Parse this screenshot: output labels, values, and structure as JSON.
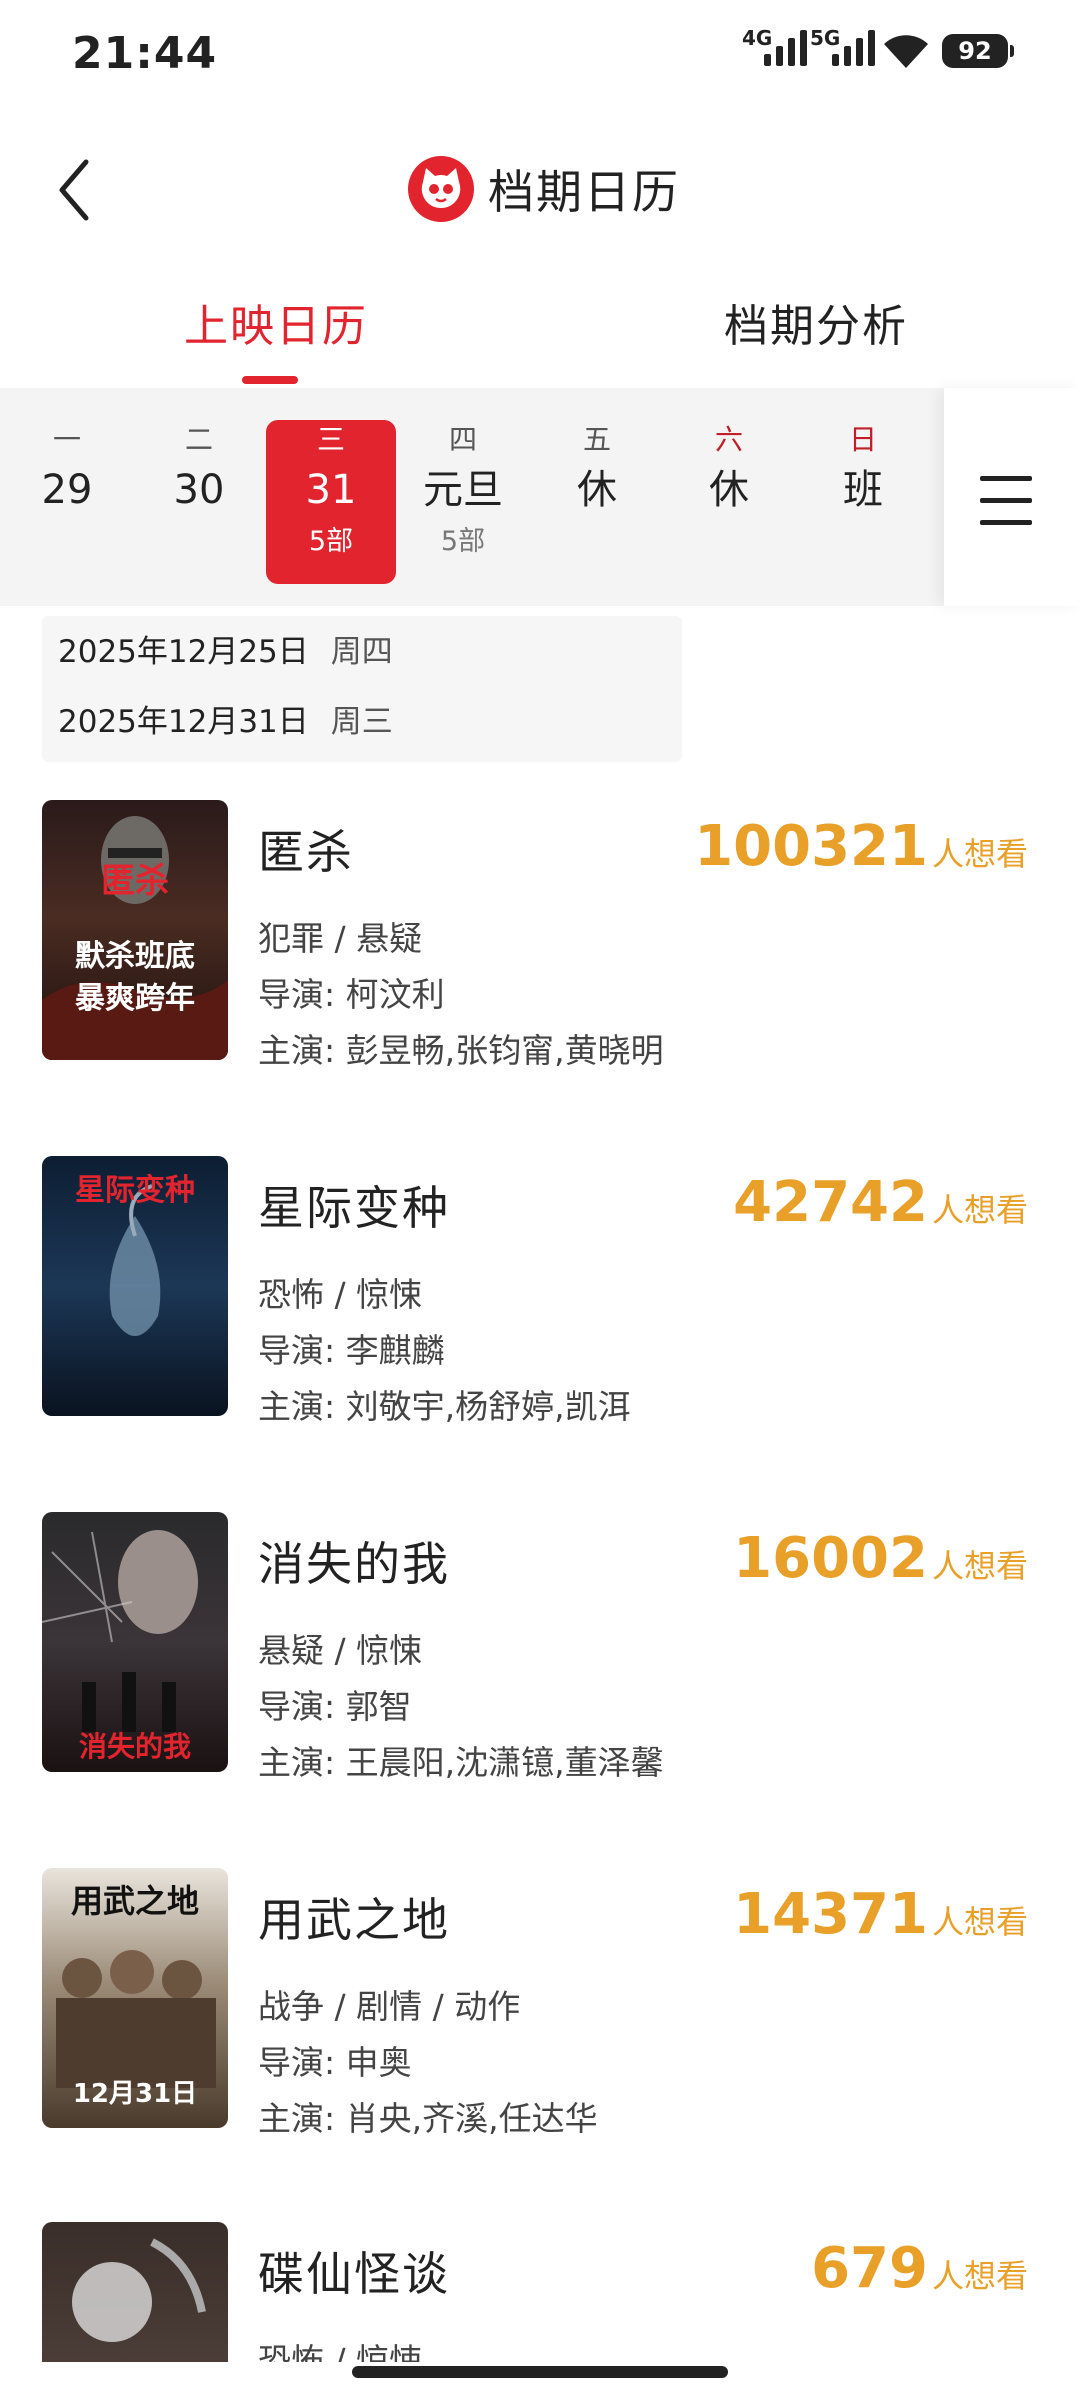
{
  "status_bar": {
    "time": "21:44",
    "network_1": "4G",
    "network_2": "5G",
    "battery": "92",
    "wifi_icon": "wifi-icon"
  },
  "header": {
    "title": "档期日历",
    "back_icon": "chevron-left-icon",
    "logo_icon": "cat-logo-icon"
  },
  "tabs": [
    {
      "label": "上映日历",
      "active": true
    },
    {
      "label": "档期分析",
      "active": false
    }
  ],
  "calendar": {
    "days": [
      {
        "weekday": "一",
        "date": "29",
        "count": ""
      },
      {
        "weekday": "二",
        "date": "30",
        "count": ""
      },
      {
        "weekday": "三",
        "date": "31",
        "count": "5部",
        "selected": true
      },
      {
        "weekday": "四",
        "date": "元旦",
        "count": "5部"
      },
      {
        "weekday": "五",
        "date": "休",
        "count": ""
      },
      {
        "weekday": "六",
        "date": "休",
        "count": "",
        "weekend": true
      },
      {
        "weekday": "日",
        "date": "班",
        "count": "",
        "weekend": true
      }
    ],
    "menu_icon": "hamburger-menu-icon"
  },
  "date_notes": [
    {
      "date": "2025年12月25日",
      "weekday": "周四"
    },
    {
      "date": "2025年12月31日",
      "weekday": "周三"
    }
  ],
  "want_label": "人想看",
  "movies": [
    {
      "title": "匿杀",
      "want": "100321",
      "genre": "犯罪 / 悬疑",
      "director": "导演: 柯汶利",
      "cast": "主演: 彭昱畅,张钧甯,黄晓明",
      "poster_text": [
        "匿杀",
        "默杀班底",
        "暴爽跨年"
      ]
    },
    {
      "title": "星际变种",
      "want": "42742",
      "genre": "恐怖 / 惊悚",
      "director": "导演: 李麒麟",
      "cast": "主演: 刘敬宇,杨舒婷,凯洱",
      "poster_text": [
        "星际变种"
      ]
    },
    {
      "title": "消失的我",
      "want": "16002",
      "genre": "悬疑 / 惊悚",
      "director": "导演: 郭智",
      "cast": "主演: 王晨阳,沈潇镱,董泽馨",
      "poster_text": [
        "消失的我"
      ]
    },
    {
      "title": "用武之地",
      "want": "14371",
      "genre": "战争 / 剧情 / 动作",
      "director": "导演: 申奥",
      "cast": "主演: 肖央,齐溪,任达华",
      "poster_text": [
        "用武之地",
        "12月31日"
      ]
    },
    {
      "title": "碟仙怪谈",
      "want": "679",
      "genre": "恐怖 / 惊悚",
      "director": "",
      "cast": "",
      "poster_text": []
    }
  ],
  "colors": {
    "accent": "#e2242e",
    "want_orange": "#e8a029"
  }
}
